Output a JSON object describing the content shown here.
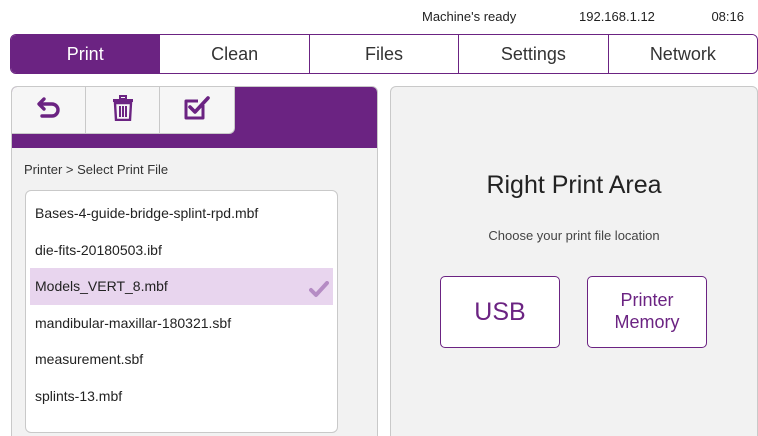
{
  "status": {
    "message": "Machine's ready",
    "ip": "192.168.1.12",
    "time": "08:16"
  },
  "tabs": [
    {
      "label": "Print",
      "active": true
    },
    {
      "label": "Clean",
      "active": false
    },
    {
      "label": "Files",
      "active": false
    },
    {
      "label": "Settings",
      "active": false
    },
    {
      "label": "Network",
      "active": false
    }
  ],
  "toolbar": {
    "icons": [
      "back-icon",
      "trash-icon",
      "checkbox-icon"
    ]
  },
  "breadcrumb": "Printer > Select Print File",
  "files": [
    {
      "name": "Bases-4-guide-bridge-splint-rpd.mbf",
      "selected": false
    },
    {
      "name": "die-fits-20180503.ibf",
      "selected": false
    },
    {
      "name": "Models_VERT_8.mbf",
      "selected": true
    },
    {
      "name": "mandibular-maxillar-180321.sbf",
      "selected": false
    },
    {
      "name": "measurement.sbf",
      "selected": false
    },
    {
      "name": "splints-13.mbf",
      "selected": false
    }
  ],
  "right_panel": {
    "title": "Right Print Area",
    "subtitle": "Choose your print file location",
    "usb_label": "USB",
    "memory_label_line1": "Printer",
    "memory_label_line2": "Memory"
  },
  "colors": {
    "accent": "#6b2382",
    "selected_row": "#e8d5ee",
    "panel_bg": "#f2f2f2"
  }
}
